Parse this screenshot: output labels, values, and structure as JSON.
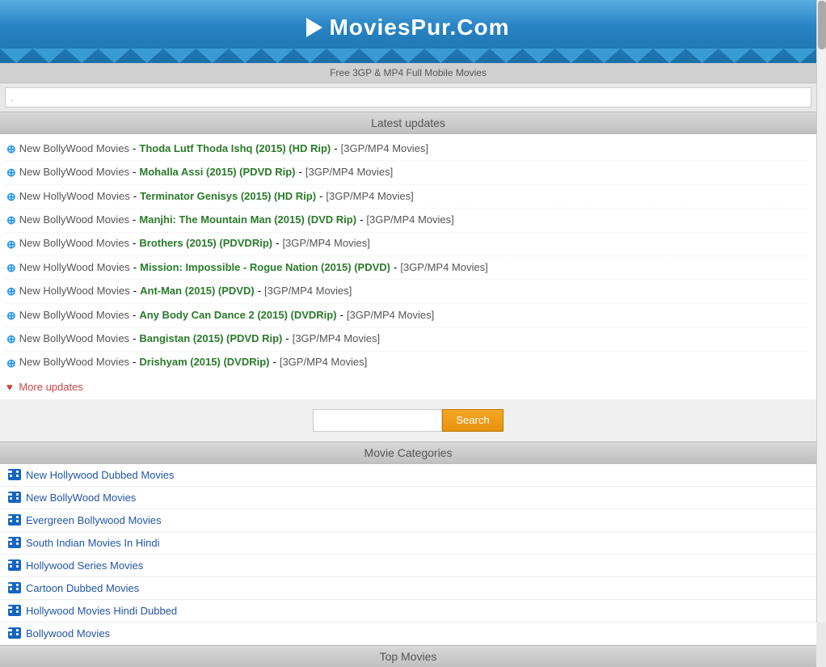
{
  "header": {
    "logo_text": "MoviesPur.Com",
    "subtitle": "Free 3GP & MP4 Full Mobile Movies"
  },
  "top_search": {
    "placeholder": "."
  },
  "latest_updates": {
    "title": "Latest updates",
    "items": [
      {
        "category": "New BollyWood Movies",
        "movie": "Thoda Lutf Thoda Ishq (2015) (HD Rip)",
        "format": "[3GP/MP4 Movies]"
      },
      {
        "category": "New BollyWood Movies",
        "movie": "Mohalla Assi (2015) (PDVD Rip)",
        "format": "[3GP/MP4 Movies]"
      },
      {
        "category": "New HollyWood Movies",
        "movie": "Terminator Genisys (2015) (HD Rip)",
        "format": "[3GP/MP4 Movies]"
      },
      {
        "category": "New BollyWood Movies",
        "movie": "Manjhi: The Mountain Man (2015) (DVD Rip)",
        "format": "[3GP/MP4 Movies]"
      },
      {
        "category": "New BollyWood Movies",
        "movie": "Brothers (2015) (PDVDRip)",
        "format": "[3GP/MP4 Movies]"
      },
      {
        "category": "New HollyWood Movies",
        "movie": "Mission: Impossible - Rogue Nation (2015) (PDVD)",
        "format": "[3GP/MP4 Movies]"
      },
      {
        "category": "New HollyWood Movies",
        "movie": "Ant-Man (2015) (PDVD)",
        "format": "[3GP/MP4 Movies]"
      },
      {
        "category": "New BollyWood Movies",
        "movie": "Any Body Can Dance 2 (2015) (DVDRip)",
        "format": "[3GP/MP4 Movies]"
      },
      {
        "category": "New BollyWood Movies",
        "movie": "Bangistan (2015) (PDVD Rip)",
        "format": "[3GP/MP4 Movies]"
      },
      {
        "category": "New BollyWood Movies",
        "movie": "Drishyam (2015) (DVDRip)",
        "format": "[3GP/MP4 Movies]"
      }
    ],
    "more_updates": "More updates"
  },
  "search": {
    "placeholder": "",
    "button_label": "Search"
  },
  "movie_categories": {
    "title": "Movie Categories",
    "items": [
      "New Hollywood Dubbed Movies",
      "New BollyWood Movies",
      "Evergreen Bollywood Movies",
      "South Indian Movies In Hindi",
      "Hollywood Series Movies",
      "Cartoon Dubbed Movies",
      "Hollywood Movies Hindi Dubbed",
      "Bollywood Movies"
    ]
  },
  "top_movies": {
    "title": "Top Movies"
  }
}
